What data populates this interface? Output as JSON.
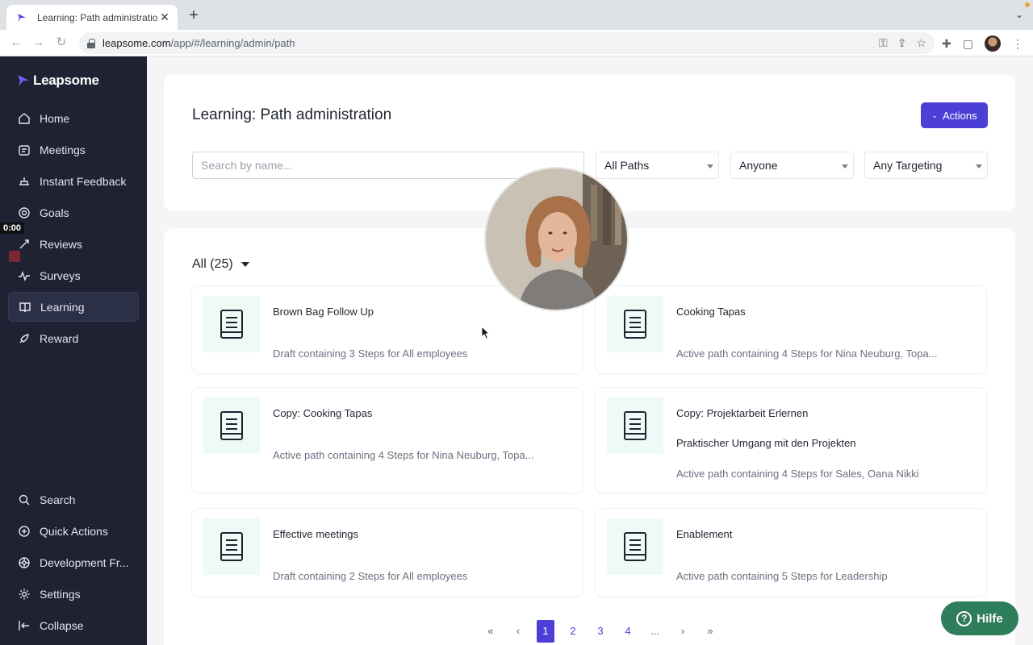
{
  "browser": {
    "tab_title": "Learning: Path administration |",
    "tab_close": "✕",
    "new_tab": "+",
    "url_host": "leapsome.com",
    "url_path": "/app/#/learning/admin/path"
  },
  "recording": {
    "timer": "0:00"
  },
  "sidebar": {
    "logo": "Leapsome",
    "top_items": [
      {
        "label": "Home",
        "icon": "home-icon"
      },
      {
        "label": "Meetings",
        "icon": "meetings-icon"
      },
      {
        "label": "Instant Feedback",
        "icon": "feedback-icon"
      },
      {
        "label": "Goals",
        "icon": "goals-icon"
      },
      {
        "label": "Reviews",
        "icon": "reviews-icon"
      },
      {
        "label": "Surveys",
        "icon": "surveys-icon"
      },
      {
        "label": "Learning",
        "icon": "learning-icon",
        "active": true
      },
      {
        "label": "Reward",
        "icon": "reward-icon"
      }
    ],
    "bottom_items": [
      {
        "label": "Search",
        "icon": "search-icon"
      },
      {
        "label": "Quick Actions",
        "icon": "quick-actions-icon"
      },
      {
        "label": "Development Fr...",
        "icon": "development-icon"
      },
      {
        "label": "Settings",
        "icon": "settings-icon"
      },
      {
        "label": "Collapse",
        "icon": "collapse-icon"
      }
    ]
  },
  "header": {
    "title": "Learning: Path administration",
    "actions_label": "Actions",
    "search_placeholder": "Search by name...",
    "filters": [
      "All Paths",
      "Anyone",
      "Any Targeting"
    ]
  },
  "list": {
    "filter_label": "All (25)",
    "paths": [
      {
        "name": "Brown Bag Follow Up",
        "subtitle": "",
        "description": "Draft containing 3 Steps for All employees"
      },
      {
        "name": "Cooking Tapas",
        "subtitle": "",
        "description": "Active path containing 4 Steps for Nina Neuburg, Topa..."
      },
      {
        "name": "Copy: Cooking Tapas",
        "subtitle": "",
        "description": "Active path containing 4 Steps for Nina Neuburg, Topa..."
      },
      {
        "name": "Copy: Projektarbeit Erlernen",
        "subtitle": "Praktischer Umgang mit den Projekten",
        "description": "Active path containing 4 Steps for Sales, Oana Nikki"
      },
      {
        "name": "Effective meetings",
        "subtitle": "",
        "description": "Draft containing 2 Steps for All employees"
      },
      {
        "name": "Enablement",
        "subtitle": "",
        "description": "Active path containing 5 Steps for Leadership"
      }
    ],
    "pagination": [
      "«",
      "‹",
      "1",
      "2",
      "3",
      "4",
      "...",
      "›",
      "»"
    ],
    "current_page": "1"
  },
  "help": {
    "label": "Hilfe"
  },
  "colors": {
    "accent": "#4b3fd6",
    "sidebar_bg": "#1e2233",
    "help_bg": "#2e7d5b",
    "thumb_bg": "#edfaf5"
  }
}
